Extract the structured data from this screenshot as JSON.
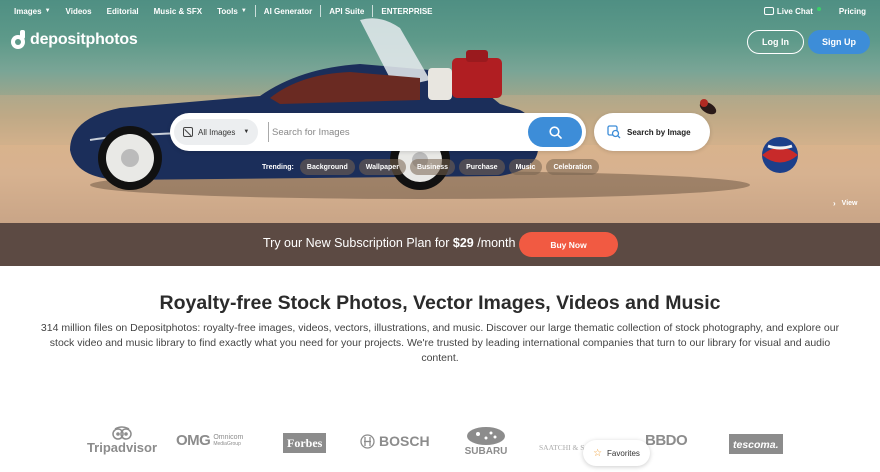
{
  "nav": {
    "items": [
      {
        "label": "Images",
        "caret": true
      },
      {
        "label": "Videos",
        "caret": false
      },
      {
        "label": "Editorial",
        "caret": false
      },
      {
        "label": "Music & SFX",
        "caret": false
      },
      {
        "label": "Tools",
        "caret": true
      },
      {
        "label": "AI Generator",
        "caret": false
      },
      {
        "label": "API Suite",
        "caret": false
      },
      {
        "label": "ENTERPRISE",
        "caret": false
      }
    ],
    "live_chat": "Live Chat",
    "pricing": "Pricing"
  },
  "brand": {
    "name": "depositphotos"
  },
  "auth": {
    "login": "Log In",
    "signup": "Sign Up"
  },
  "search": {
    "type_selected": "All Images",
    "placeholder": "Search for Images",
    "search_by_image": "Search by Image"
  },
  "trending": {
    "label": "Trending:",
    "tags": [
      "Background",
      "Wallpaper",
      "Business",
      "Purchase",
      "Music",
      "Celebration"
    ]
  },
  "hero": {
    "view_label": "View"
  },
  "promo": {
    "text_before": "Try our New Subscription Plan for ",
    "price": "$29",
    "text_after": " /month",
    "button": "Buy Now"
  },
  "main": {
    "headline": "Royalty-free Stock Photos, Vector Images, Videos and Music",
    "description": "314 million files on Depositphotos: royalty-free images, videos, vectors, illustrations, and music. Discover our large thematic collection of stock photography, and explore our stock video and music library to find exactly what you need for your projects. We're trusted by leading international companies that turn to our library for visual and audio content."
  },
  "clients": {
    "tripadvisor": "Tripadvisor",
    "omg": "OMG",
    "omg_sub1": "Omnicom",
    "omg_sub2": "MediaGroup",
    "forbes": "Forbes",
    "bosch": "BOSCH",
    "subaru": "SUBARU",
    "saatchi": "SAATCHI & SAATCHI",
    "bbdo": "BBDO",
    "tescoma": "tescoma."
  },
  "favorites": {
    "label": "Favorites"
  },
  "colors": {
    "accent_blue": "#3d8dd8",
    "promo_bg": "#5c4a43",
    "buy_now": "#f15a42"
  }
}
